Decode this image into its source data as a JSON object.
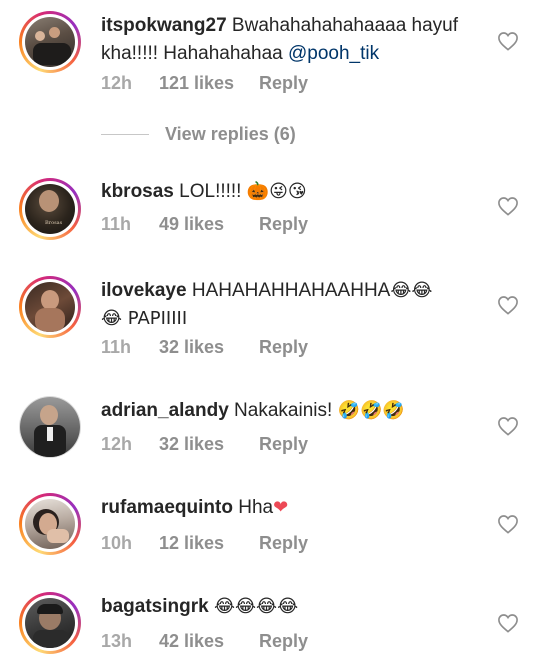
{
  "comments": [
    {
      "username": "itspokwang27",
      "text": " Bwahahahahahaaaa hayuf kha!!!!! Hahahahahaa ",
      "mention": "@pooh_tik",
      "time": "12h",
      "likes": "121 likes",
      "reply": "Reply"
    },
    {
      "username": "kbrosas",
      "text": " LOL!!!!! ",
      "emoji": "🎃😜😘",
      "time": "11h",
      "likes": "49 likes",
      "reply": "Reply"
    },
    {
      "username": "ilovekaye",
      "text": " HAHAHAHHAHAAHHA",
      "emoji": "😂😂",
      "text2": "😂 PAPIIIII",
      "time": "11h",
      "likes": "32 likes",
      "reply": "Reply"
    },
    {
      "username": "adrian_alandy",
      "text": " Nakakainis! ",
      "emoji": "🤣🤣🤣",
      "time": "12h",
      "likes": "32 likes",
      "reply": "Reply"
    },
    {
      "username": "rufamaequinto",
      "text": " Hha",
      "emoji": "❤",
      "time": "10h",
      "likes": "12 likes",
      "reply": "Reply"
    },
    {
      "username": "bagatsingrk",
      "text": " ",
      "emoji": "😂😂😂😂",
      "time": "13h",
      "likes": "42 likes",
      "reply": "Reply"
    }
  ],
  "view_replies": "View replies (6)",
  "colors": {
    "text": "#262626",
    "meta": "#8e8e8e",
    "mention": "#003569",
    "heart_red": "#ed4956"
  },
  "icons": {
    "like": "heart-outline-icon"
  }
}
